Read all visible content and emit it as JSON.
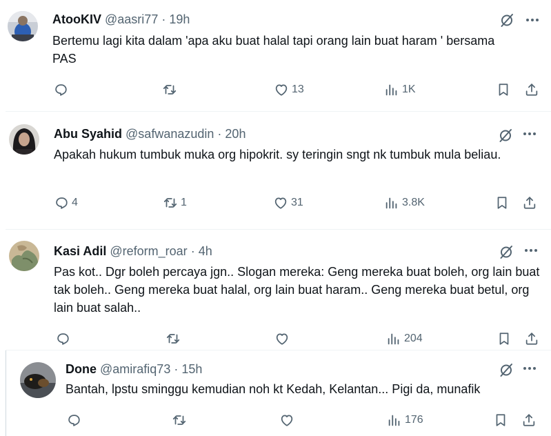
{
  "tweets": [
    {
      "name": "AtooKIV",
      "handle": "@aasri77",
      "sep": "·",
      "time": "19h",
      "text": "Bertemu lagi kita dalam 'apa aku buat halal tapi orang lain buat haram ' bersama  PAS",
      "replies": "",
      "retweets": "",
      "likes": "13",
      "views": "1K"
    },
    {
      "name": "Abu Syahid",
      "handle": "@safwanazudin",
      "sep": "·",
      "time": "20h",
      "text": "Apakah hukum tumbuk muka org hipokrit. sy teringin sngt nk tumbuk mula beliau.",
      "replies": "4",
      "retweets": "1",
      "likes": "31",
      "views": "3.8K"
    },
    {
      "name": "Kasi Adil",
      "handle": "@reform_roar",
      "sep": "·",
      "time": "4h",
      "text": "Pas kot.. Dgr boleh percaya jgn.. Slogan mereka: Geng mereka buat boleh, org lain buat tak boleh.. Geng mereka buat halal, org lain buat haram.. Geng mereka buat betul, org lain buat salah..",
      "replies": "",
      "retweets": "",
      "likes": "",
      "views": "204"
    },
    {
      "name": "Done",
      "handle": "@amirafiq73",
      "sep": "·",
      "time": "15h",
      "text": "Bantah, lpstu sminggu kemudian noh kt Kedah, Kelantan... Pigi da, munafik",
      "replies": "",
      "retweets": "",
      "likes": "",
      "views": "176"
    }
  ],
  "colors": {
    "text": "#0f1419",
    "muted": "#536471",
    "divider": "#eff3f4"
  },
  "icons": [
    "grok-icon",
    "more-icon",
    "reply-icon",
    "retweet-icon",
    "like-icon",
    "views-icon",
    "bookmark-icon",
    "share-icon"
  ]
}
